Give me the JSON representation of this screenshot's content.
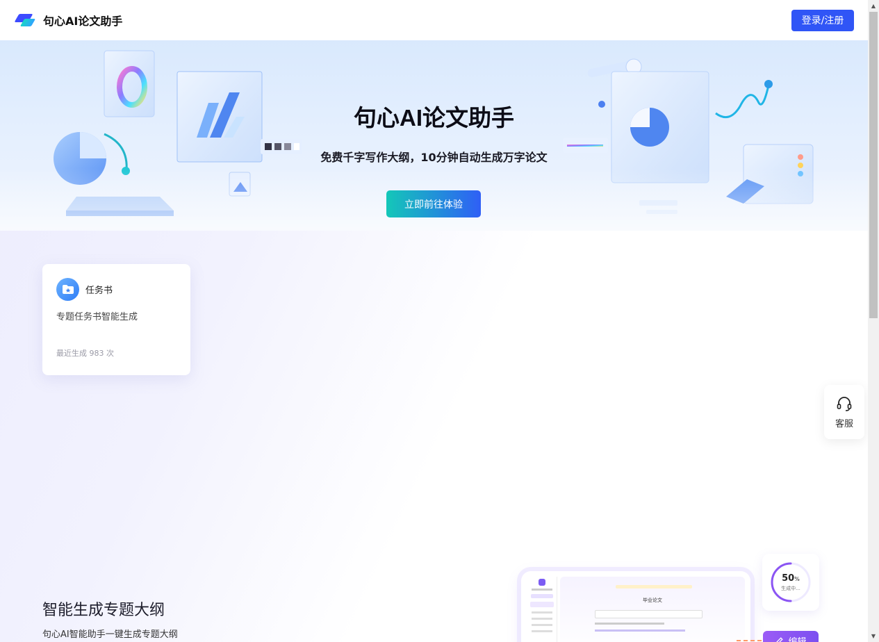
{
  "header": {
    "brand": "句心AI论文助手",
    "login_label": "登录/注册"
  },
  "hero": {
    "title": "句心AI论文助手",
    "subtitle": "免费千字写作大纲，10分钟自动生成万字论文",
    "cta_label": "立即前往体验"
  },
  "task_card": {
    "title": "任务书",
    "description": "专题任务书智能生成",
    "count_text": "最近生成 983 次"
  },
  "service": {
    "label": "客服"
  },
  "feature": {
    "title": "智能生成专题大纲",
    "description": "句心AI智能助手一键生成专题大纲",
    "mockup_title": "毕业论文",
    "progress_value": "50",
    "progress_unit": "%",
    "progress_text": "生成中...",
    "edit_label": "编辑"
  },
  "colors": {
    "primary": "#3055f6",
    "cta_start": "#14c7b8",
    "cta_end": "#2f5ff6",
    "accent_purple": "#8b55f3"
  },
  "icons": {
    "service": "headset-icon",
    "card": "folder-star-icon",
    "edit": "pencil-icon"
  }
}
